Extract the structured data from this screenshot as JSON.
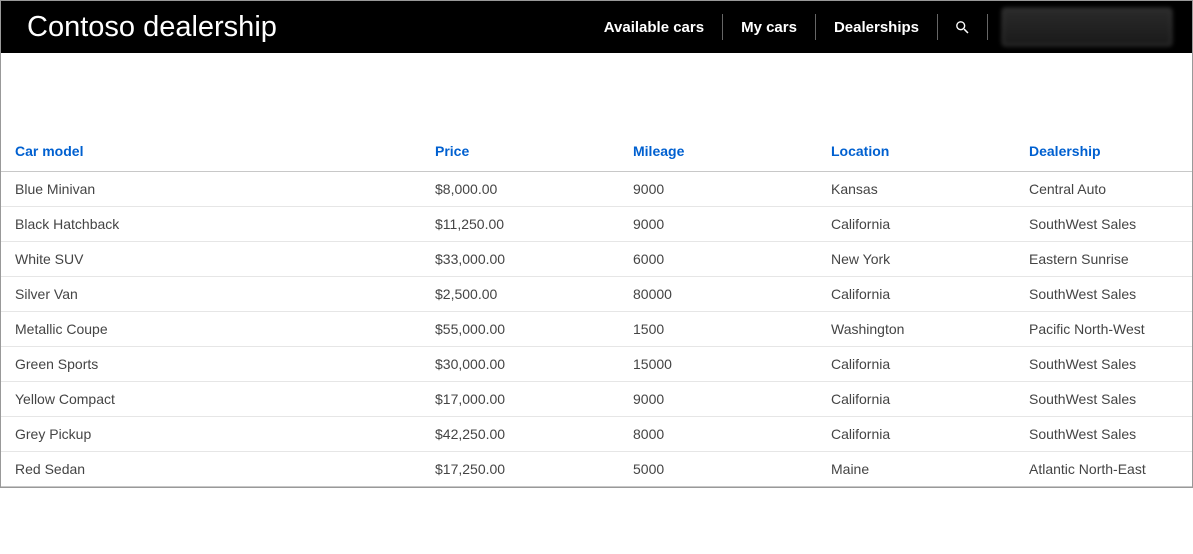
{
  "header": {
    "brand": "Contoso dealership",
    "nav": {
      "available_cars": "Available cars",
      "my_cars": "My cars",
      "dealerships": "Dealerships"
    }
  },
  "table": {
    "columns": {
      "car_model": "Car model",
      "price": "Price",
      "mileage": "Mileage",
      "location": "Location",
      "dealership": "Dealership"
    },
    "rows": [
      {
        "car_model": "Blue Minivan",
        "price": "$8,000.00",
        "mileage": "9000",
        "location": "Kansas",
        "dealership": "Central Auto"
      },
      {
        "car_model": "Black Hatchback",
        "price": "$11,250.00",
        "mileage": "9000",
        "location": "California",
        "dealership": "SouthWest Sales"
      },
      {
        "car_model": "White SUV",
        "price": "$33,000.00",
        "mileage": "6000",
        "location": "New York",
        "dealership": "Eastern Sunrise"
      },
      {
        "car_model": "Silver Van",
        "price": "$2,500.00",
        "mileage": "80000",
        "location": "California",
        "dealership": "SouthWest Sales"
      },
      {
        "car_model": "Metallic Coupe",
        "price": "$55,000.00",
        "mileage": "1500",
        "location": "Washington",
        "dealership": "Pacific North-West"
      },
      {
        "car_model": "Green Sports",
        "price": "$30,000.00",
        "mileage": "15000",
        "location": "California",
        "dealership": "SouthWest Sales"
      },
      {
        "car_model": "Yellow Compact",
        "price": "$17,000.00",
        "mileage": "9000",
        "location": "California",
        "dealership": "SouthWest Sales"
      },
      {
        "car_model": "Grey Pickup",
        "price": "$42,250.00",
        "mileage": "8000",
        "location": "California",
        "dealership": "SouthWest Sales"
      },
      {
        "car_model": "Red Sedan",
        "price": "$17,250.00",
        "mileage": "5000",
        "location": "Maine",
        "dealership": "Atlantic North-East"
      }
    ]
  }
}
